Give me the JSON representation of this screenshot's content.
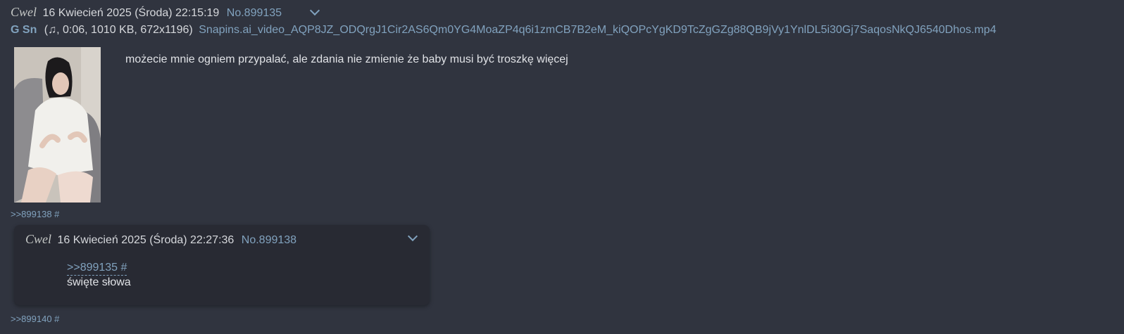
{
  "post": {
    "name": "Cwel",
    "date": "16 Kwiecień 2025 (Środa) 22:15:19",
    "number": "No.899135",
    "file": {
      "label": "G Sn",
      "meta": "(♫, 0:06, 1010 KB, 672x1196)",
      "filename": "Snapins.ai_video_AQP8JZ_ODQrgJ1Cir2AS6Qm0YG4MoaZP4q6i1zmCB7B2eM_kiQOPcYgKD9TcZgGZg88QB9jVy1YnlDL5i30Gj7SaqosNkQJ6540Dhos.mp4"
    },
    "message": "możecie mnie ogniem przypalać, ale zdania nie zmienie że baby musi być troszkę więcej",
    "backlink": ">>899138 #"
  },
  "reply": {
    "name": "Cwel",
    "date": "16 Kwiecień 2025 (Środa) 22:27:36",
    "number": "No.899138",
    "quote": ">>899135 #",
    "message": "święte słowa"
  },
  "backlink_2": ">>899140 #"
}
